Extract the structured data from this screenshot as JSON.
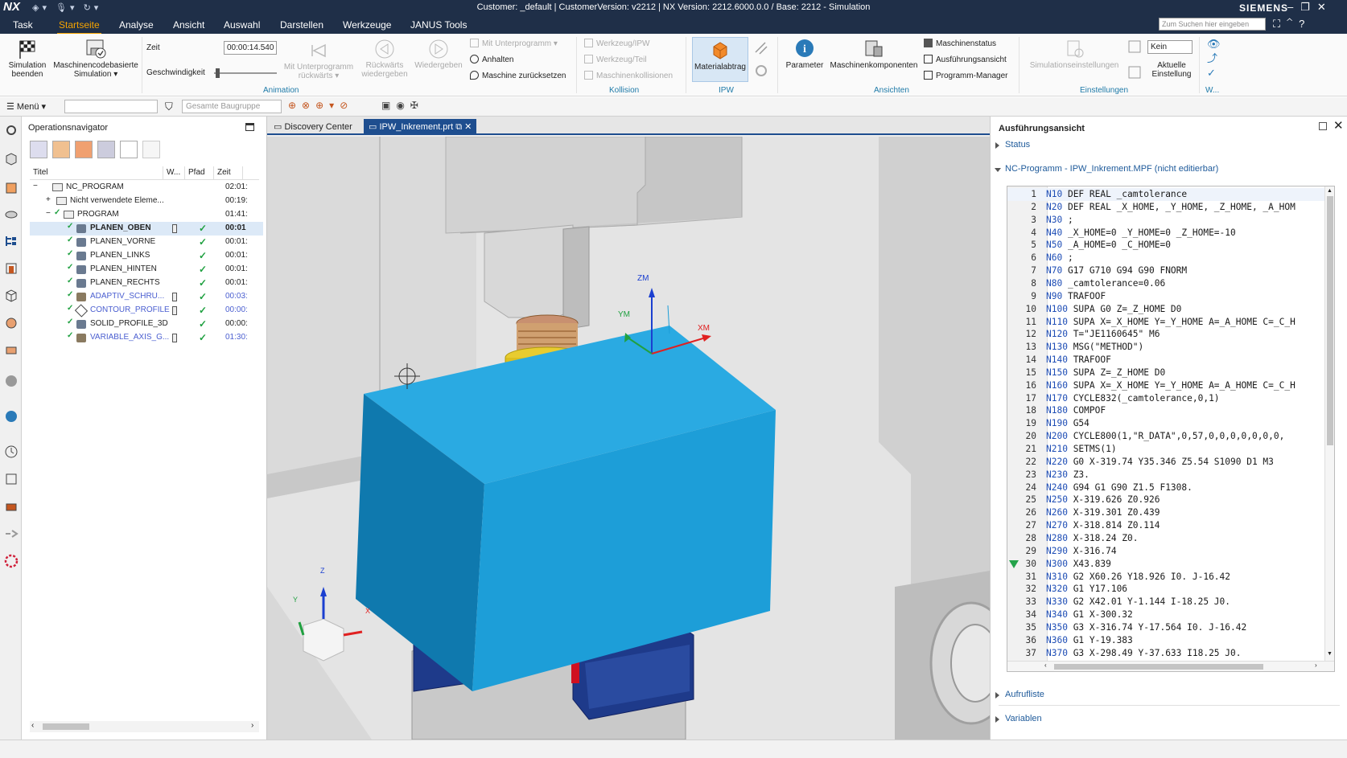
{
  "titlebar": {
    "logo": "NX",
    "title": "Customer: _default | CustomerVersion: v2212 | NX Version: 2212.6000.0.0 / Base: 2212 - Simulation",
    "brand": "SIEMENS"
  },
  "menu": {
    "tabs": [
      "Task",
      "Startseite",
      "Analyse",
      "Ansicht",
      "Auswahl",
      "Darstellen",
      "Werkzeuge",
      "JANUS Tools"
    ],
    "active": "Startseite",
    "search_placeholder": "Zum Suchen hier eingeben"
  },
  "ribbon": {
    "sim_end": "Simulation beenden",
    "mcode_sim": "Maschinencodebasierte Simulation",
    "zeit_label": "Zeit",
    "zeit_value": "00:00:14.540",
    "speed_label": "Geschwindigkeit",
    "mit_up_back": "Mit Unterprogramm rückwärts",
    "rueckwaerts": "Rückwärts wiedergeben",
    "wiedergeben": "Wiedergeben",
    "mit_up": "Mit Unterprogramm",
    "anhalten": "Anhalten",
    "reset": "Maschine zurücksetzen",
    "group_animation": "Animation",
    "wz_ipw": "Werkzeug/IPW",
    "wz_teil": "Werkzeug/Teil",
    "maschkoll": "Maschinenkollisionen",
    "group_kollision": "Kollision",
    "materialabtrag": "Materialabtrag",
    "group_ipw": "IPW",
    "parameter": "Parameter",
    "maschkomp": "Maschinenkomponenten",
    "maschstatus": "Maschinenstatus",
    "ausfansicht": "Ausführungsansicht",
    "progmgr": "Programm-Manager",
    "group_ansichten": "Ansichten",
    "simeinst": "Simulationseinstellungen",
    "kein": "Kein",
    "akt_einst": "Aktuelle Einstellung",
    "group_einstellungen": "Einstellungen",
    "group_w": "W..."
  },
  "toolbar2": {
    "menu": "Menü",
    "filter": "",
    "baugruppe": "Gesamte Baugruppe"
  },
  "opnav": {
    "title": "Operationsnavigator",
    "columns": [
      "Titel",
      "W...",
      "Pfad",
      "Zeit"
    ],
    "rows": [
      {
        "name": "NC_PROGRAM",
        "time": "02:01:"
      },
      {
        "name": "Nicht verwendete Eleme...",
        "time": "00:19:"
      },
      {
        "name": "PROGRAM",
        "time": "01:41:"
      },
      {
        "name": "PLANEN_OBEN",
        "time": "00:01"
      },
      {
        "name": "PLANEN_VORNE",
        "time": "00:01:"
      },
      {
        "name": "PLANEN_LINKS",
        "time": "00:01:"
      },
      {
        "name": "PLANEN_HINTEN",
        "time": "00:01:"
      },
      {
        "name": "PLANEN_RECHTS",
        "time": "00:01:"
      },
      {
        "name": "ADAPTIV_SCHRU...",
        "time": "00:03:"
      },
      {
        "name": "CONTOUR_PROFILE",
        "time": "00:00:"
      },
      {
        "name": "SOLID_PROFILE_3D",
        "time": "00:00:"
      },
      {
        "name": "VARIABLE_AXIS_G...",
        "time": "01:30:"
      }
    ]
  },
  "viewport": {
    "tabs": [
      "Discovery Center",
      "IPW_Inkrement.prt"
    ],
    "axes": {
      "zm": "ZM",
      "xm": "XM",
      "ym": "YM",
      "z": "Z",
      "x": "X",
      "y": "Y"
    }
  },
  "right": {
    "title": "Ausführungsansicht",
    "status": "Status",
    "nc_title": "NC-Programm - IPW_Inkrement.MPF (nicht editierbar)",
    "aufrufliste": "Aufrufliste",
    "variablen": "Variablen",
    "code": [
      "N10 DEF REAL _camtolerance",
      "N20 DEF REAL _X_HOME, _Y_HOME, _Z_HOME, _A_HOM",
      "N30 ;",
      "N40 _X_HOME=0 _Y_HOME=0 _Z_HOME=-10",
      "N50 _A_HOME=0 _C_HOME=0",
      "N60 ;",
      "N70 G17 G710 G94 G90 FNORM",
      "N80 _camtolerance=0.06",
      "N90 TRAFOOF",
      "N100 SUPA G0 Z=_Z_HOME D0",
      "N110 SUPA X=_X_HOME Y=_Y_HOME A=_A_HOME C=_C_H",
      "N120 T=\"JE1160645\" M6",
      "N130 MSG(\"METHOD\")",
      "N140 TRAFOOF",
      "N150 SUPA Z=_Z_HOME D0",
      "N160 SUPA X=_X_HOME Y=_Y_HOME A=_A_HOME C=_C_H",
      "N170 CYCLE832(_camtolerance,0,1)",
      "N180 COMPOF",
      "N190 G54",
      "N200 CYCLE800(1,\"R_DATA\",0,57,0,0,0,0,0,0,0,",
      "N210 SETMS(1)",
      "N220 G0 X-319.74 Y35.346 Z5.54 S1090 D1 M3",
      "N230 Z3.",
      "N240 G94 G1 G90 Z1.5 F1308.",
      "N250 X-319.626 Z0.926",
      "N260 X-319.301 Z0.439",
      "N270 X-318.814 Z0.114",
      "N280 X-318.24 Z0.",
      "N290 X-316.74",
      "N300 X43.839",
      "N310 G2 X60.26 Y18.926 I0. J-16.42",
      "N320 G1 Y17.106",
      "N330 G2 X42.01 Y-1.144 I-18.25 J0.",
      "N340 G1 X-300.32",
      "N350 G3 X-316.74 Y-17.564 I0. J-16.42",
      "N360 G1 Y-19.383",
      "N370 G3 X-298.49 Y-37.633 I18.25 J0."
    ],
    "current_line": 30
  }
}
